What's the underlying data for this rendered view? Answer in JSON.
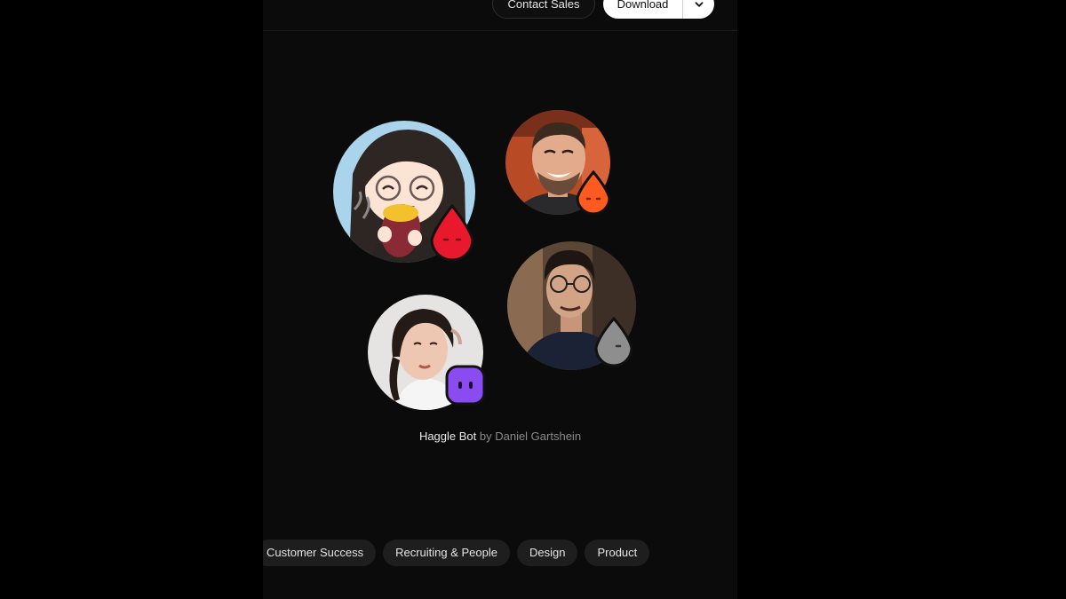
{
  "header": {
    "contact_label": "Contact Sales",
    "download_label": "Download"
  },
  "avatars": [
    {
      "name": "anime-girl-avatar",
      "badge": "red-drop-mascot",
      "badge_color": "#e8192c"
    },
    {
      "name": "smiling-man-avatar",
      "badge": "orange-drop-mascot",
      "badge_color": "#ff5a1f"
    },
    {
      "name": "glasses-man-avatar",
      "badge": "gray-drop-mascot",
      "badge_color": "#8e8e8e"
    },
    {
      "name": "woman-avatar",
      "badge": "purple-square-mascot",
      "badge_color": "#8a4cf0"
    }
  ],
  "caption": {
    "bot_name": "Haggle Bot",
    "byline": " by Daniel Gartshein"
  },
  "categories": [
    "Customer Success",
    "Recruiting & People",
    "Design",
    "Product"
  ],
  "colors": {
    "background": "#000000",
    "pill_bg": "#1e1e1e",
    "download_bg": "#ffffff"
  }
}
